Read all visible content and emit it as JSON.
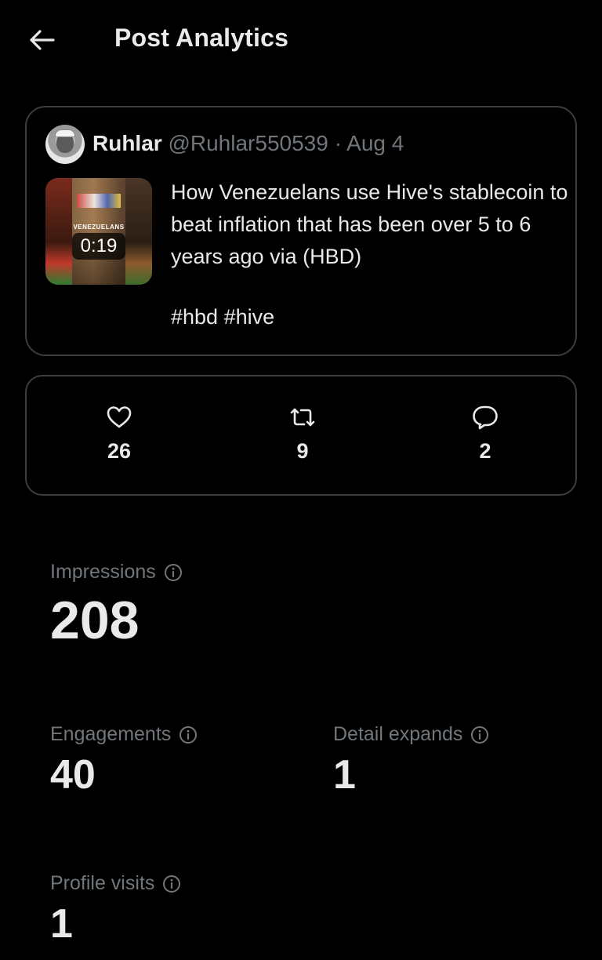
{
  "header": {
    "title": "Post Analytics",
    "back_icon": "arrow-left-icon"
  },
  "post": {
    "author_name": "Ruhlar",
    "author_handle": "@Ruhlar550539",
    "separator": "·",
    "date": "Aug 4",
    "thumbnail_caption": "VENEZUELANS",
    "video_duration": "0:19",
    "text": "How Venezuelans use Hive's stablecoin to beat inflation that has been over 5 to 6 years ago via (HBD)",
    "hashtags": "#hbd #hive"
  },
  "engagement_stats": {
    "likes": "26",
    "reposts": "9",
    "replies": "2"
  },
  "metrics": {
    "impressions": {
      "label": "Impressions",
      "value": "208"
    },
    "engagements": {
      "label": "Engagements",
      "value": "40"
    },
    "detail_expands": {
      "label": "Detail expands",
      "value": "1"
    },
    "profile_visits": {
      "label": "Profile visits",
      "value": "1"
    }
  },
  "colors": {
    "background": "#000000",
    "text_primary": "#e7e9ea",
    "text_secondary": "#71767b",
    "border": "#3a3d41"
  }
}
